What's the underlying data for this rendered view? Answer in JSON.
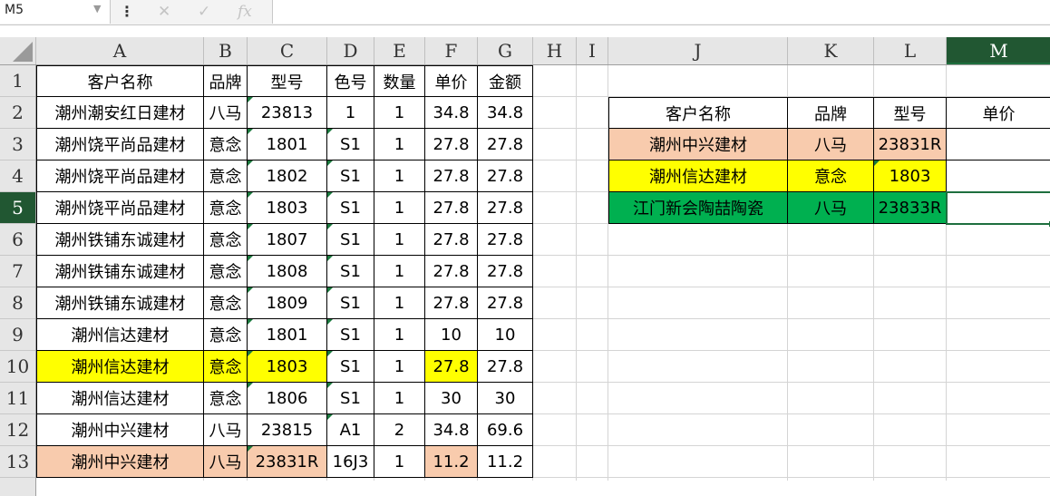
{
  "formula_bar": {
    "name_box": "M5",
    "fx_label": "fx",
    "formula": ""
  },
  "columns": [
    "A",
    "B",
    "C",
    "D",
    "E",
    "F",
    "G",
    "H",
    "I",
    "J",
    "K",
    "L",
    "M"
  ],
  "active_column": "M",
  "active_row": 5,
  "rows": [
    "1",
    "2",
    "3",
    "4",
    "5",
    "6",
    "7",
    "8",
    "9",
    "10",
    "11",
    "12",
    "13"
  ],
  "colors": {
    "peach": "#f8cbad",
    "yellow": "#ffff00",
    "green": "#00b050",
    "selection": "#1e6f3e",
    "header_bg": "#e6e6e6"
  },
  "table_main": {
    "headers": [
      "客户名称",
      "品牌",
      "型号",
      "色号",
      "数量",
      "单价",
      "金额"
    ],
    "rows": [
      [
        "潮州潮安红日建材",
        "八马",
        "23813",
        "1",
        "1",
        "34.8",
        "34.8"
      ],
      [
        "潮州饶平尚品建材",
        "意念",
        "1801",
        "S1",
        "1",
        "27.8",
        "27.8"
      ],
      [
        "潮州饶平尚品建材",
        "意念",
        "1802",
        "S1",
        "1",
        "27.8",
        "27.8"
      ],
      [
        "潮州饶平尚品建材",
        "意念",
        "1803",
        "S1",
        "1",
        "27.8",
        "27.8"
      ],
      [
        "潮州铁铺东诚建材",
        "意念",
        "1807",
        "S1",
        "1",
        "27.8",
        "27.8"
      ],
      [
        "潮州铁铺东诚建材",
        "意念",
        "1808",
        "S1",
        "1",
        "27.8",
        "27.8"
      ],
      [
        "潮州铁铺东诚建材",
        "意念",
        "1809",
        "S1",
        "1",
        "27.8",
        "27.8"
      ],
      [
        "潮州信达建材",
        "意念",
        "1801",
        "S1",
        "1",
        "10",
        "10"
      ],
      [
        "潮州信达建材",
        "意念",
        "1803",
        "S1",
        "1",
        "27.8",
        "27.8"
      ],
      [
        "潮州信达建材",
        "意念",
        "1806",
        "S1",
        "1",
        "30",
        "30"
      ],
      [
        "潮州中兴建材",
        "八马",
        "23815",
        "A1",
        "2",
        "34.8",
        "69.6"
      ],
      [
        "潮州中兴建材",
        "八马",
        "23831R",
        "16J3",
        "1",
        "11.2",
        "11.2"
      ]
    ]
  },
  "table_lookup": {
    "headers": [
      "客户名称",
      "品牌",
      "型号",
      "单价"
    ],
    "rows": [
      [
        "潮州中兴建材",
        "八马",
        "23831R",
        ""
      ],
      [
        "潮州信达建材",
        "意念",
        "1803",
        ""
      ],
      [
        "江门新会陶喆陶瓷",
        "八马",
        "23833R",
        ""
      ]
    ]
  }
}
